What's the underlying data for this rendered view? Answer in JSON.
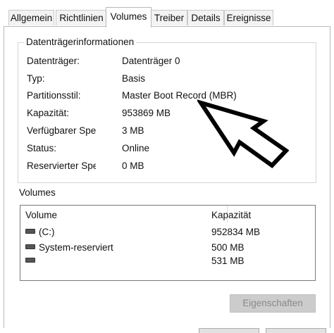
{
  "tabs": [
    {
      "label": "Allgemein",
      "active": false
    },
    {
      "label": "Richtlinien",
      "active": false
    },
    {
      "label": "Volumes",
      "active": true
    },
    {
      "label": "Treiber",
      "active": false
    },
    {
      "label": "Details",
      "active": false
    },
    {
      "label": "Ereignisse",
      "active": false
    }
  ],
  "disk_info": {
    "title": "Datenträgerinformationen",
    "rows": [
      {
        "label": "Datenträger:",
        "value": "Datenträger 0"
      },
      {
        "label": "Typ:",
        "value": "Basis"
      },
      {
        "label": "Partitionsstil:",
        "value": "Master Boot Record (MBR)"
      },
      {
        "label": "Kapazität:",
        "value": "953869 MB"
      },
      {
        "label": "Verfügbarer Speicher:",
        "value": "3 MB"
      },
      {
        "label": "Status:",
        "value": "Online"
      },
      {
        "label": "Reservierter Speicher:",
        "value": "0 MB"
      }
    ]
  },
  "volumes": {
    "title": "Volumes",
    "header_volume": "Volume",
    "header_capacity": "Kapazität",
    "rows": [
      {
        "name": "(C:)",
        "capacity": "952834 MB",
        "icon": "drive-icon"
      },
      {
        "name": "System-reserviert",
        "capacity": "500 MB",
        "icon": "drive-icon"
      },
      {
        "name": "",
        "capacity": "531 MB",
        "icon": "drive-icon"
      }
    ]
  },
  "button": {
    "properties_label": "Eigenschaften"
  }
}
